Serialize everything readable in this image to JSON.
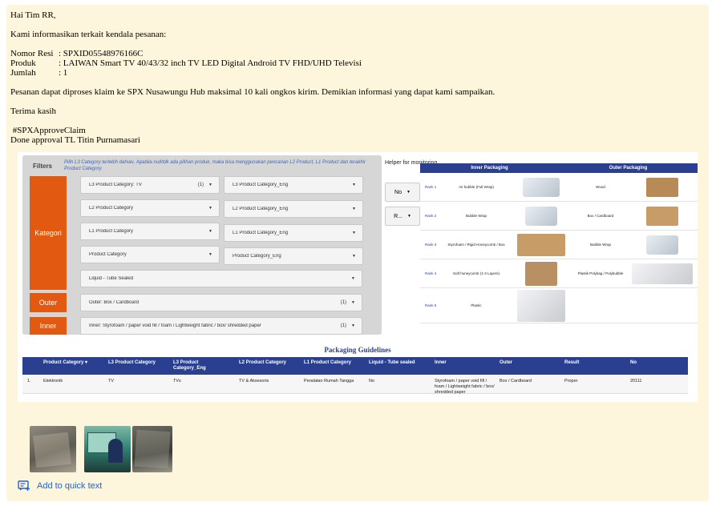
{
  "message": {
    "greeting": "Hai Tim RR,",
    "intro": "Kami informasikan terkait kendala pesanan:",
    "fields": [
      {
        "label": "Nomor Resi",
        "value": ": SPXID05548976166C"
      },
      {
        "label": "Produk",
        "value": ": LAIWAN Smart TV 40/43/32 inch TV LED Digital Android TV FHD/UHD Televisi"
      },
      {
        "label": "Jumlah",
        "value": ": 1"
      }
    ],
    "body": "Pesanan dapat diproses klaim ke SPX Nusawungu Hub maksimal 10 kali ongkos kirim. Demikian informasi yang dapat kami sampaikan.",
    "thanks": "Terima kasih",
    "hashtag": " #SPXApproveClaim",
    "approval": "Done approval TL Titin Purnamasari"
  },
  "screenshot": {
    "filters_title": "Filters",
    "hint": "Pilih L3 Category terlebih dahulu. Apabila null/tdk ada pilihan produk, maka bisa menggunakan pencarian L2 Product, L1 Product dan terakhir Product Category",
    "side_labels": {
      "kategori": "Kategori",
      "outer": "Outer",
      "inner": "Inner"
    },
    "dropdowns": {
      "l3": "L3 Product Category: TV",
      "l3_count": "(1)",
      "l3_eng": "L3 Product Category_Eng",
      "l2": "L2 Product Category",
      "l2_eng": "L2 Product Category_Eng",
      "l1": "L1 Product Category",
      "l1_eng": "L1 Product Category_Eng",
      "pc": "Product Category",
      "pc_eng": "Product Category_Eng",
      "liquid": "Liquid - Tube Sealed",
      "outer": "Outer: Box / Cardboard",
      "outer_count": "(1)",
      "inner": "Inner: Styrofoam / paper void fill / foam / Lightweight fabric / box/ shredded paper",
      "inner_count": "(1)"
    },
    "helper": {
      "title": "Helper for monitoring",
      "btn1": "No",
      "btn2": "R..."
    },
    "packaging_headers": {
      "inner": "Inner Packaging",
      "outer": "Outer Packaging"
    },
    "packaging_rows": [
      {
        "rank": "Rank 1",
        "inner": "Air bubble (Full Wrap)",
        "outer": "Wood"
      },
      {
        "rank": "Rank 2",
        "inner": "Bubble Wrap",
        "outer": "Box / Cardboard"
      },
      {
        "rank": "Rank 3",
        "inner": "Styrofoam / Rigid Honeycomb / Box",
        "outer": "Bubble Wrap"
      },
      {
        "rank": "Rank 4",
        "inner": "Soft honeycomb (1-3 Layers)",
        "outer": "Plastik Polybag / Polybubble"
      },
      {
        "rank": "Rank 5",
        "inner": "Plastic",
        "outer": ""
      }
    ],
    "guidelines_title": "Packaging Guidelines",
    "table_headers": [
      "Product Category ▾",
      "L3 Product Category",
      "L3 Product Category_Eng",
      "L2 Product Category",
      "L1 Product Category",
      "Liquid - Tube sealed",
      "Inner",
      "Outer",
      "Result",
      "No"
    ],
    "table_row": [
      "1.",
      "Elektronik",
      "TV",
      "TVs",
      "TV & Aksesoris",
      "Peralatan Rumah Tangga",
      "No",
      "Styrofoam / paper void fill / foam / Lightweight fabric / box/ shredded paper",
      "Box / Cardboard",
      "Proper",
      "20111"
    ]
  },
  "attachments": [
    "thumbnail-1",
    "thumbnail-2",
    "thumbnail-3"
  ],
  "quick_text_label": "Add to quick text",
  "colors": {
    "card_bg": "#fdf5dc",
    "accent_orange": "#e25a12",
    "navy": "#2a3f8f",
    "link": "#2563c9"
  }
}
